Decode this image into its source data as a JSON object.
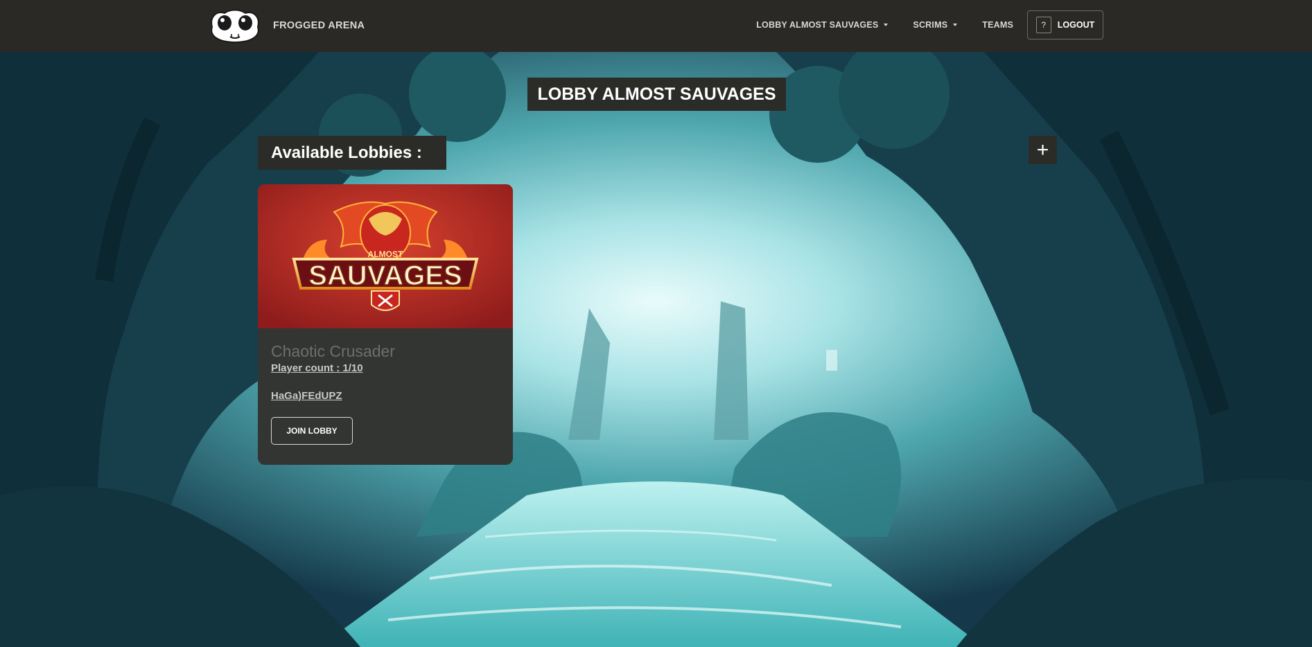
{
  "navbar": {
    "brand_name": "FROGGED ARENA",
    "links": [
      {
        "label": "LOBBY ALMOST SAUVAGES",
        "dropdown": true
      },
      {
        "label": "SCRIMS",
        "dropdown": true
      },
      {
        "label": "TEAMS",
        "dropdown": false
      }
    ],
    "help_icon_glyph": "?",
    "logout_label": "LOGOUT"
  },
  "main": {
    "page_title": "LOBBY ALMOST SAUVAGES",
    "section_title": "Available Lobbies :",
    "add_button_glyph": "+",
    "lobbies": [
      {
        "logo_top_text": "ALMOST",
        "logo_main_text": "SAUVAGES",
        "name": "Chaotic Crusader",
        "player_count": "Player count : 1/10",
        "code": "HaGa)FEdUPZ",
        "join_label": "JOIN LOBBY"
      }
    ]
  },
  "colors": {
    "navbar_bg": "#2b2925",
    "panel_bg": "#2b2b28",
    "card_bg": "#333532",
    "jungle_light": "#bfeef0",
    "jungle_dark": "#0e2a35"
  }
}
